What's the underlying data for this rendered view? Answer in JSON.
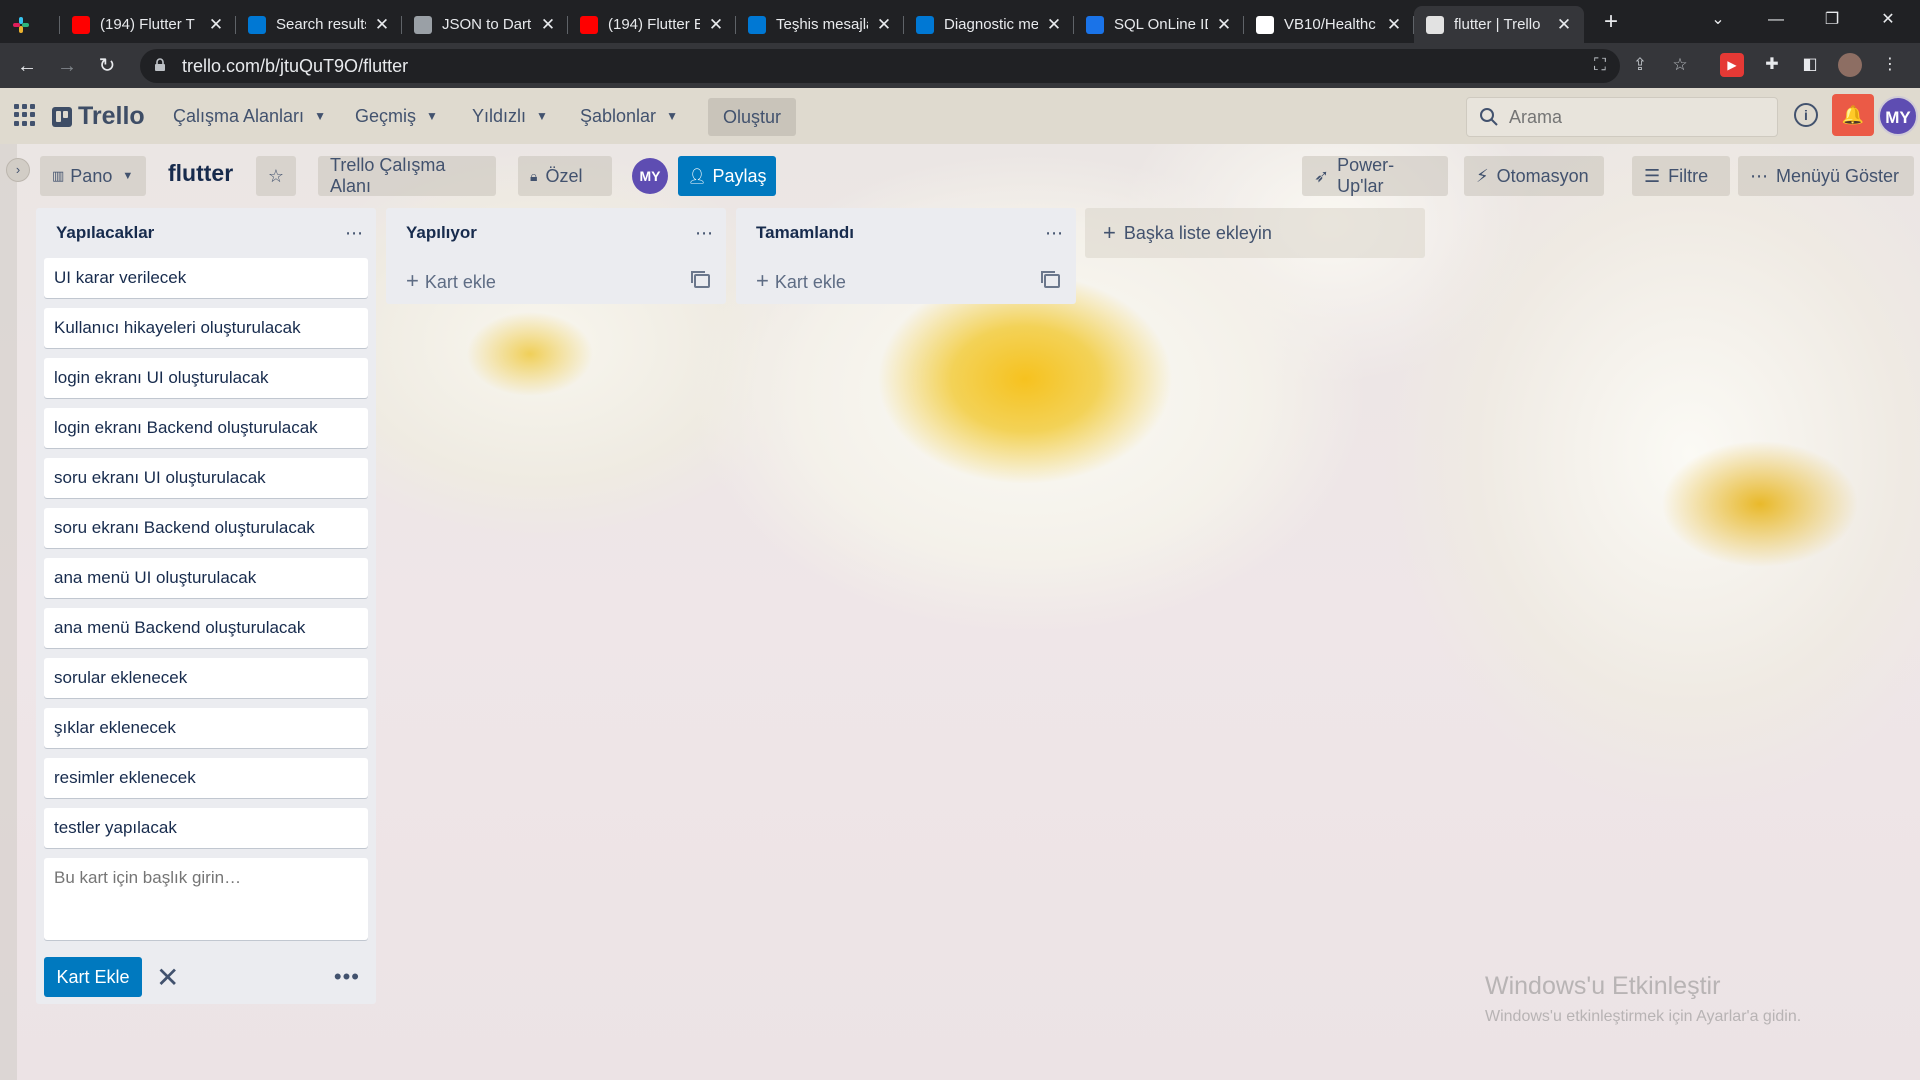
{
  "browser": {
    "tabs": [
      {
        "title": "(194) Flutter T",
        "favicon": "youtube-icon",
        "color": "#ff0000"
      },
      {
        "title": "Search results",
        "favicon": "azure-devops-icon",
        "color": "#0078d4"
      },
      {
        "title": "JSON to Dart",
        "favicon": "globe-icon",
        "color": "#9aa0a6"
      },
      {
        "title": "(194) Flutter E",
        "favicon": "youtube-icon",
        "color": "#ff0000"
      },
      {
        "title": "Teşhis mesajla",
        "favicon": "azure-devops-icon",
        "color": "#0078d4"
      },
      {
        "title": "Diagnostic me",
        "favicon": "azure-devops-icon",
        "color": "#0078d4"
      },
      {
        "title": "SQL OnLine IDE",
        "favicon": "sql-icon",
        "color": "#1a73e8"
      },
      {
        "title": "VB10/Healthc",
        "favicon": "github-icon",
        "color": "#ffffff"
      },
      {
        "title": "flutter | Trello",
        "favicon": "trello-icon",
        "color": "#e2e2e2"
      }
    ],
    "url": "trello.com/b/jtuQuT9O/flutter"
  },
  "header": {
    "logo": "Trello",
    "menus": [
      "Çalışma Alanları",
      "Geçmiş",
      "Yıldızlı",
      "Şablonlar"
    ],
    "create": "Oluştur",
    "search_placeholder": "Arama",
    "avatar": "MY"
  },
  "boardbar": {
    "view": "Pano",
    "title": "flutter",
    "workspace": "Trello Çalışma Alanı",
    "visibility": "Özel",
    "member": "MY",
    "share": "Paylaş",
    "powerups": "Power-Up'lar",
    "automation": "Otomasyon",
    "filter": "Filtre",
    "show_menu": "Menüyü Göster"
  },
  "lists": [
    {
      "title": "Yapılacaklar",
      "cards": [
        "UI karar verilecek",
        "Kullanıcı hikayeleri oluşturulacak",
        "login ekranı UI oluşturulacak",
        "login ekranı Backend oluşturulacak",
        "soru ekranı UI oluşturulacak",
        "soru ekranı Backend oluşturulacak",
        "ana menü UI oluşturulacak",
        "ana menü Backend oluşturulacak",
        "sorular eklenecek",
        "şıklar eklenecek",
        "resimler eklenecek",
        "testler yapılacak"
      ],
      "composer_placeholder": "Bu kart için başlık girin…",
      "composer_button": "Kart Ekle"
    },
    {
      "title": "Yapılıyor",
      "add_card": "Kart ekle"
    },
    {
      "title": "Tamamlandı",
      "add_card": "Kart ekle"
    }
  ],
  "add_list": "Başka liste ekleyin",
  "watermark": {
    "title": "Windows'u Etkinleştir",
    "subtitle": "Windows'u etkinleştirmek için Ayarlar'a gidin."
  }
}
